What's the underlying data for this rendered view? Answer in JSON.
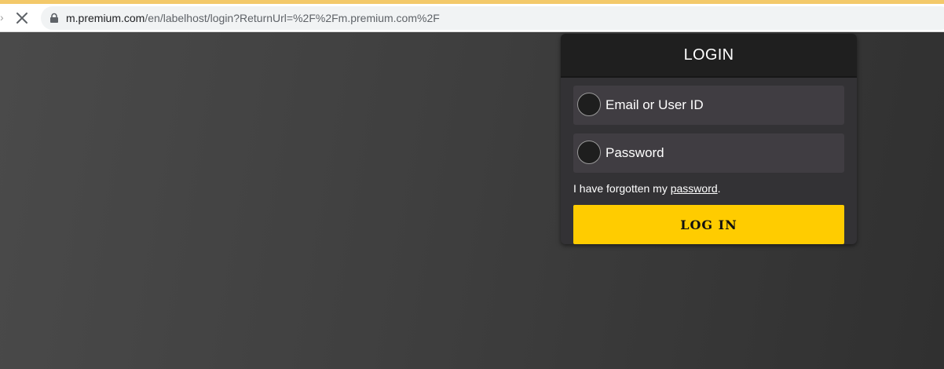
{
  "browser": {
    "url_host": "m.premium.com",
    "url_path": "/en/labelhost/login?ReturnUrl=%2F%2Fm.premium.com%2F"
  },
  "login": {
    "title": "LOGIN",
    "email_label": "Email or User ID",
    "password_label": "Password",
    "forgot_prefix": "I have forgotten my ",
    "forgot_link": "password",
    "forgot_suffix": ".",
    "submit_label": "LOG IN"
  },
  "colors": {
    "accent": "#ffcc00",
    "panel_header": "#1f1f1f",
    "panel_body": "#333235",
    "field": "#403d42"
  },
  "icons": {
    "stop": "close-icon",
    "lock": "lock-icon"
  }
}
